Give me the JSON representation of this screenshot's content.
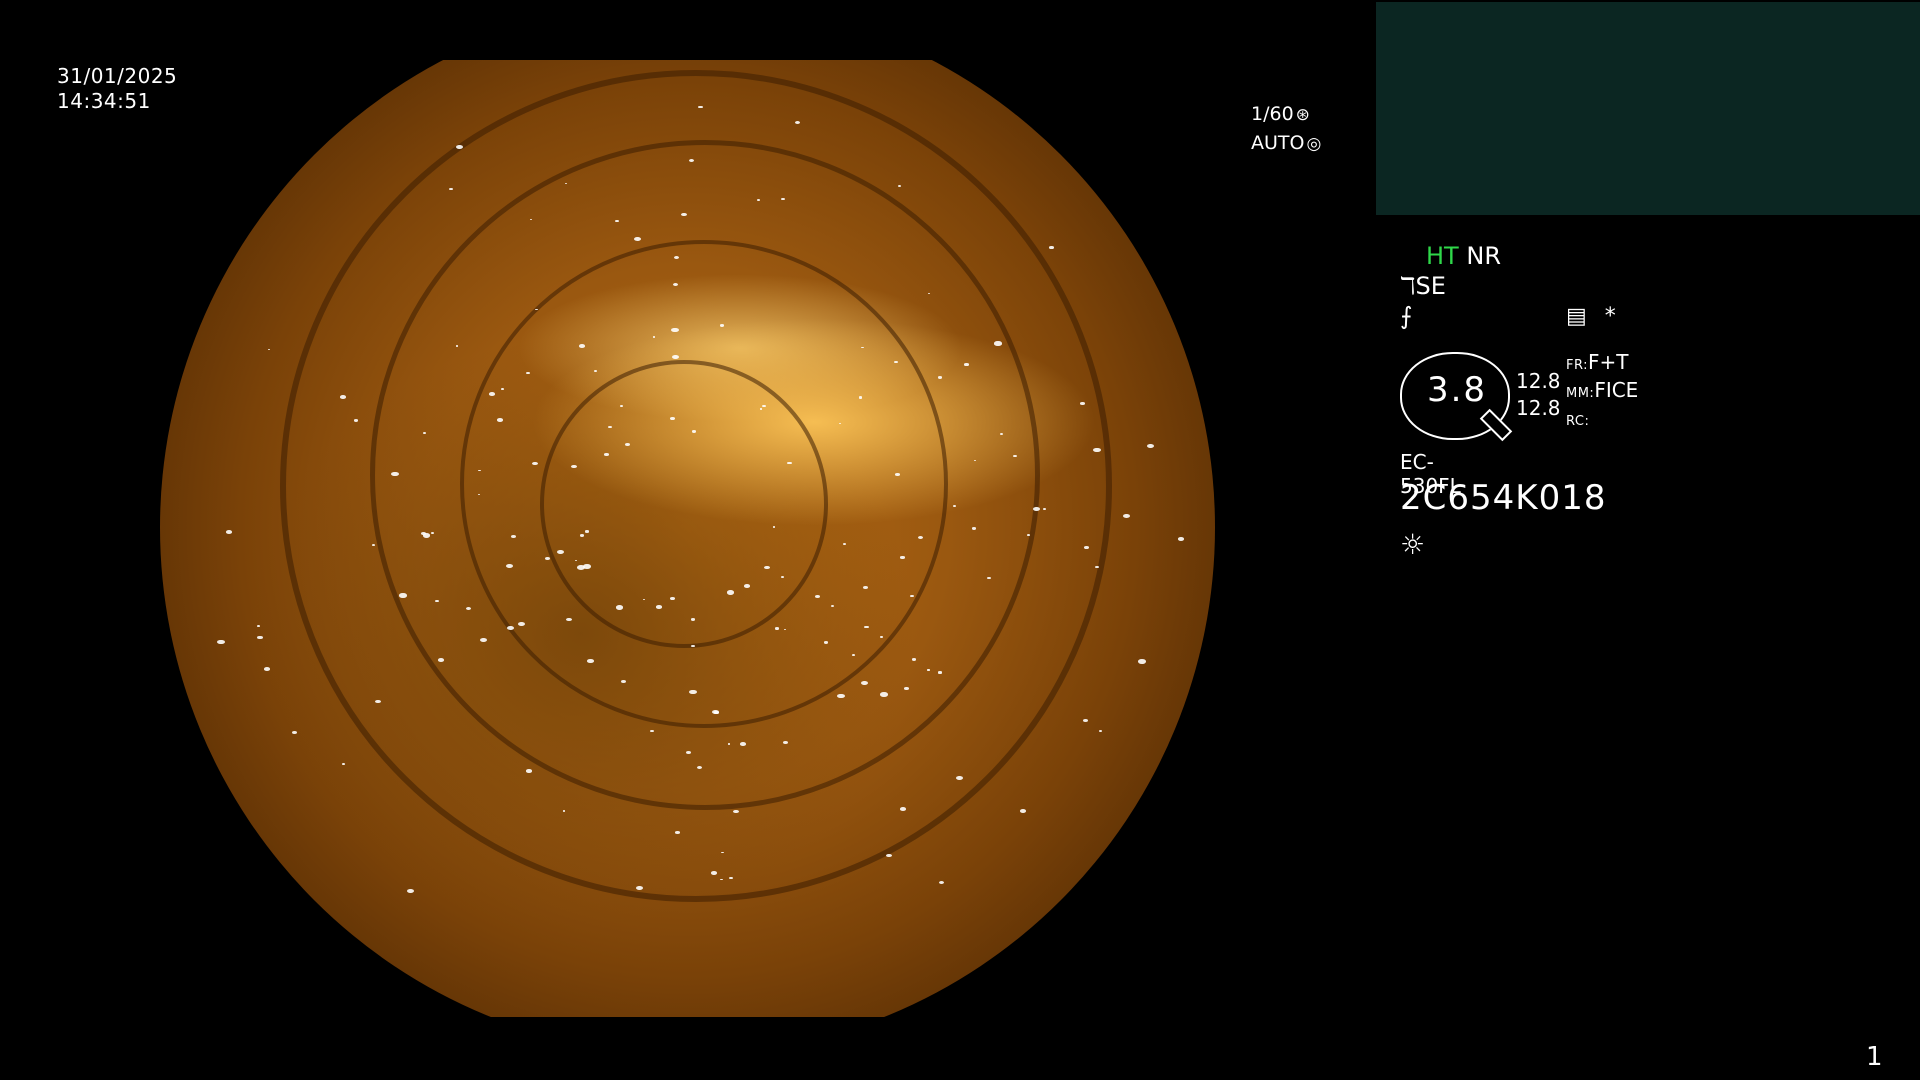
{
  "datetime": {
    "date": "31/01/2025",
    "time": "14:34:51"
  },
  "shutter": {
    "speed": "1/60",
    "speed_icon": "aperture-icon",
    "mode": "AUTO",
    "mode_icon": "iris-icon"
  },
  "osd": {
    "ht_label": "HT",
    "nr_label": "NR",
    "se_label": "SE",
    "se_icon": "structure-enhance-icon",
    "freeze_icon": "freeze-icon",
    "menu_icon": "menu-list-icon",
    "star_label": "*",
    "gauge_value": "3.8",
    "mag_values": [
      "12.8",
      "12.8"
    ],
    "modes": [
      {
        "key": "FR:",
        "value": "F+T"
      },
      {
        "key": "MM:",
        "value": "FICE"
      },
      {
        "key": "RC:",
        "value": ""
      }
    ],
    "scope_model": "EC-530FL",
    "scope_serial": "2C654K018",
    "light_icon": "light-source-icon"
  },
  "colors": {
    "ht_green": "#2fd84a",
    "thumbnail_bg": "#0b2622",
    "tissue": "#b46a14"
  },
  "page_number": "1"
}
